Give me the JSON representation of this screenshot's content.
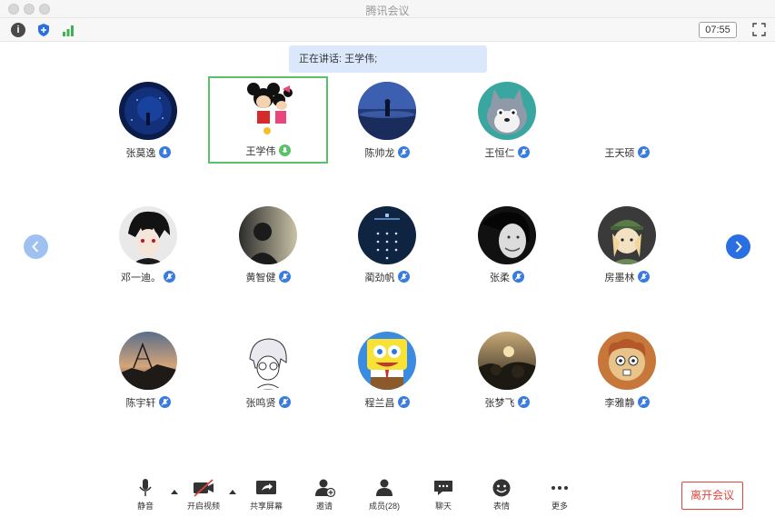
{
  "window": {
    "title": "腾讯会议"
  },
  "toolbar": {
    "timer": "07:55",
    "info_icon": "info-icon",
    "security_icon": "shield-icon",
    "network_icon": "signal-bars-icon"
  },
  "banner": {
    "speaking_text": "正在讲话: 王学伟;"
  },
  "colors": {
    "accent": "#2a6fe2",
    "active_border": "#58c16a",
    "leave": "#e0453c",
    "mic": "#3a7be0",
    "banner_bg": "#dbe8fb"
  },
  "participants": [
    {
      "name": "张莫逸",
      "active": false
    },
    {
      "name": "王学伟",
      "active": true
    },
    {
      "name": "陈帅龙",
      "active": false
    },
    {
      "name": "王恒仁",
      "active": false
    },
    {
      "name": "王天硕",
      "active": false
    },
    {
      "name": "邓一迪。",
      "active": false
    },
    {
      "name": "黄智健",
      "active": false
    },
    {
      "name": "蔺劲帆",
      "active": false
    },
    {
      "name": "张柔",
      "active": false
    },
    {
      "name": "房墨林",
      "active": false
    },
    {
      "name": "陈宇轩",
      "active": false
    },
    {
      "name": "张鸣贤",
      "active": false
    },
    {
      "name": "程兰昌",
      "active": false
    },
    {
      "name": "张梦飞",
      "active": false
    },
    {
      "name": "李雅静",
      "active": false
    }
  ],
  "controls": {
    "mute": "静音",
    "video": "开启视频",
    "share": "共享屏幕",
    "invite": "邀请",
    "members": "成员(28)",
    "chat": "聊天",
    "reactions": "表情",
    "more": "更多",
    "leave": "离开会议"
  }
}
